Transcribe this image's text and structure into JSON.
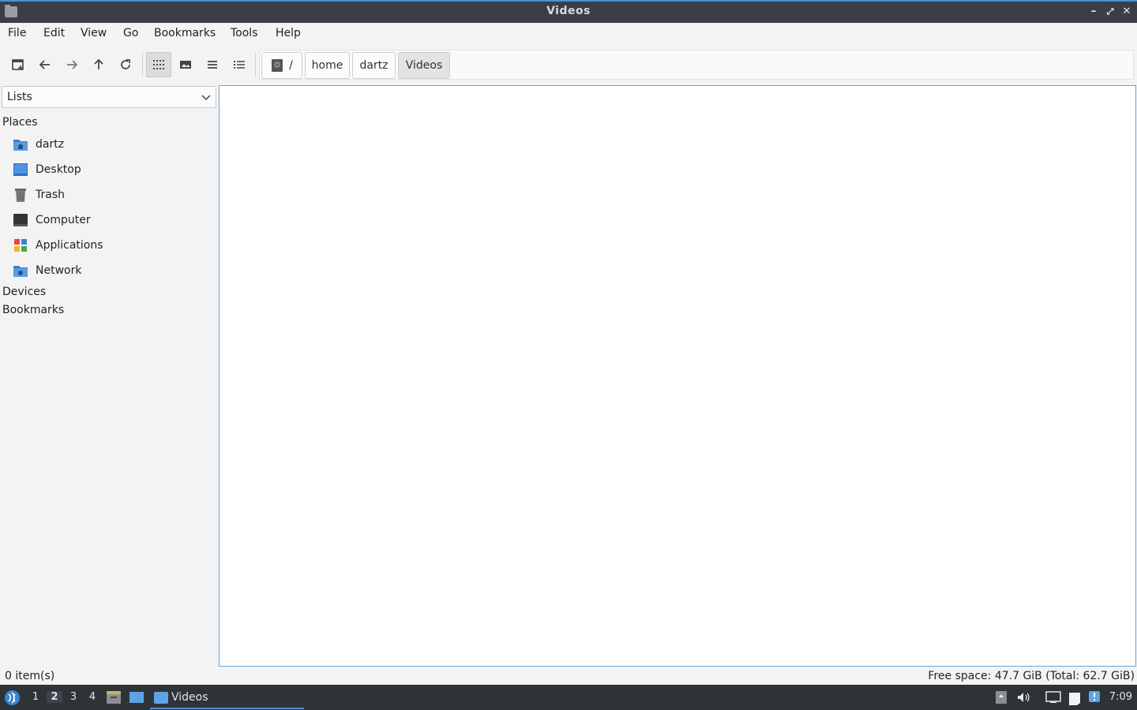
{
  "window": {
    "title": "Videos",
    "controls": {
      "minimize": "–",
      "maximize": "⤢",
      "close": "✕"
    }
  },
  "menubar": {
    "items": [
      {
        "label": "File"
      },
      {
        "label": "Edit"
      },
      {
        "label": "View"
      },
      {
        "label": "Go"
      },
      {
        "label": "Bookmarks"
      },
      {
        "label": "Tools"
      },
      {
        "label": "Help"
      }
    ]
  },
  "toolbar": {
    "buttons": [
      {
        "icon": "new-tab-icon"
      },
      {
        "icon": "back-arrow-icon"
      },
      {
        "icon": "forward-arrow-icon"
      },
      {
        "icon": "up-arrow-icon"
      },
      {
        "icon": "reload-icon"
      },
      {
        "icon": "icon-view-icon",
        "active": true
      },
      {
        "icon": "thumbnail-view-icon"
      },
      {
        "icon": "compact-view-icon"
      },
      {
        "icon": "detailed-list-view-icon"
      }
    ]
  },
  "path": {
    "segments": [
      {
        "label": "/",
        "icon": "disk-icon"
      },
      {
        "label": "home"
      },
      {
        "label": "dartz"
      },
      {
        "label": "Videos",
        "current": true
      }
    ]
  },
  "sidepane": {
    "mode": "Lists",
    "sections": {
      "places": "Places",
      "devices": "Devices",
      "bookmarks": "Bookmarks"
    },
    "places": [
      {
        "label": "dartz",
        "icon": "home-folder-icon"
      },
      {
        "label": "Desktop",
        "icon": "desktop-icon"
      },
      {
        "label": "Trash",
        "icon": "trash-icon"
      },
      {
        "label": "Computer",
        "icon": "computer-icon"
      },
      {
        "label": "Applications",
        "icon": "applications-icon"
      },
      {
        "label": "Network",
        "icon": "network-folder-icon"
      }
    ]
  },
  "statusbar": {
    "items": "0 item(s)",
    "space": "Free space: 47.7 GiB (Total: 62.7 GiB)"
  },
  "taskbar": {
    "workspaces": [
      "1",
      "2",
      "3",
      "4"
    ],
    "active_workspace": "2",
    "task": "Videos",
    "clock": "7:09"
  },
  "colors": {
    "accent": "#4a90d9",
    "titlebar": "#3b3f45",
    "taskbar": "#2e3338"
  }
}
